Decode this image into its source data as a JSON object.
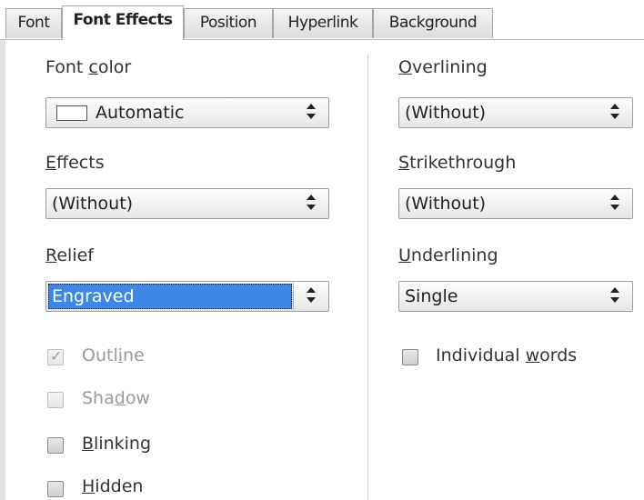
{
  "tabs": [
    {
      "label": "Font",
      "active": false
    },
    {
      "label": "Font Effects",
      "active": true
    },
    {
      "label": "Position",
      "active": false
    },
    {
      "label": "Hyperlink",
      "active": false
    },
    {
      "label": "Background",
      "active": false
    }
  ],
  "left": {
    "font_color": {
      "label_pre": "Font ",
      "label_key": "c",
      "label_post": "olor",
      "value": "Automatic",
      "swatch_color": "#ffffff"
    },
    "effects": {
      "label_pre": "",
      "label_key": "E",
      "label_post": "ffects",
      "value": "(Without)"
    },
    "relief": {
      "label_pre": "",
      "label_key": "R",
      "label_post": "elief",
      "value": "Engraved"
    },
    "outline": {
      "label_pre": "Outl",
      "label_key": "i",
      "label_post": "ne",
      "checked": true,
      "enabled": false
    },
    "shadow": {
      "label_pre": "Sha",
      "label_key": "d",
      "label_post": "ow",
      "checked": false,
      "enabled": false
    },
    "blinking": {
      "label_pre": "",
      "label_key": "B",
      "label_post": "linking",
      "checked": false,
      "enabled": true
    },
    "hidden": {
      "label_pre": "",
      "label_key": "H",
      "label_post": "idden",
      "checked": false,
      "enabled": true
    }
  },
  "right": {
    "overlining": {
      "label_pre": "",
      "label_key": "O",
      "label_post": "verlining",
      "value": "(Without)"
    },
    "strikethrough": {
      "label_pre": "",
      "label_key": "S",
      "label_post": "trikethrough",
      "value": "(Without)"
    },
    "underlining": {
      "label_pre": "",
      "label_key": "U",
      "label_post": "nderlining",
      "value": "Single"
    },
    "individual_words": {
      "label_pre": "Individual ",
      "label_key": "w",
      "label_post": "ords",
      "checked": false,
      "enabled": true
    }
  },
  "colors": {
    "selection": "#3d87e8"
  }
}
